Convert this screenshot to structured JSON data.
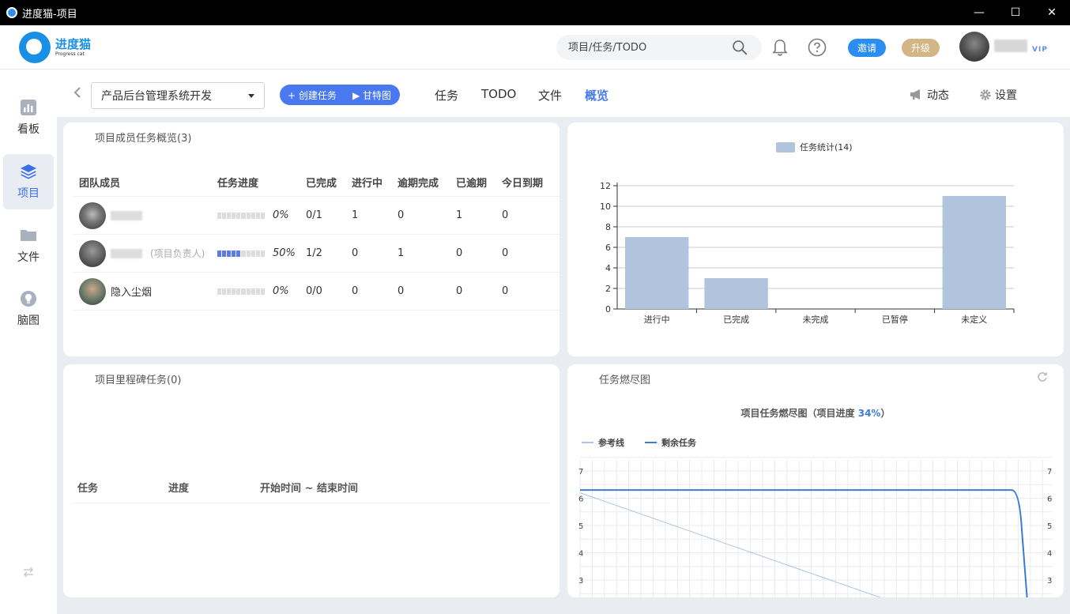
{
  "window": {
    "title": "进度猫-项目",
    "minimize": "—",
    "maximize": "☐",
    "close": "✕"
  },
  "header": {
    "logo_cn": "进度猫",
    "logo_en": "Progress cat",
    "search_placeholder": "项目/任务/TODO",
    "invite_label": "邀请",
    "upgrade_label": "升级",
    "vip_label": "VIP"
  },
  "sidebar": {
    "items": [
      {
        "label": "看板",
        "icon": "chart-board-icon",
        "active": false
      },
      {
        "label": "项目",
        "icon": "layers-icon",
        "active": true
      },
      {
        "label": "文件",
        "icon": "folder-icon",
        "active": false
      },
      {
        "label": "脑图",
        "icon": "bulb-icon",
        "active": false
      }
    ]
  },
  "toolbar": {
    "project_name": "产品后台管理系统开发",
    "create_task_label": "+ 创建任务",
    "gantt_label": "▶ 甘特图",
    "tabs": [
      {
        "label": "任务",
        "active": false
      },
      {
        "label": "TODO",
        "active": false
      },
      {
        "label": "文件",
        "active": false
      },
      {
        "label": "概览",
        "active": true
      }
    ],
    "activity_label": "动态",
    "settings_label": "设置"
  },
  "members_card": {
    "title": "项目成员任务概览(3)",
    "columns": [
      "团队成员",
      "任务进度",
      "已完成",
      "进行中",
      "逾期完成",
      "已逾期",
      "今日到期"
    ],
    "rows": [
      {
        "name": "",
        "role": "",
        "progress": 0,
        "progress_label": "0%",
        "done": "0/1",
        "in_progress": "1",
        "overdue_done": "0",
        "overdue": "1",
        "due_today": "0"
      },
      {
        "name": "",
        "role": "(项目负责人)",
        "progress": 0.5,
        "progress_label": "50%",
        "done": "1/2",
        "in_progress": "0",
        "overdue_done": "1",
        "overdue": "0",
        "due_today": "0"
      },
      {
        "name": "隐入尘烟",
        "role": "",
        "progress": 0,
        "progress_label": "0%",
        "done": "0/0",
        "in_progress": "0",
        "overdue_done": "0",
        "overdue": "0",
        "due_today": "0"
      }
    ]
  },
  "milestone_card": {
    "title": "项目里程碑任务(0)",
    "columns": [
      "任务",
      "进度",
      "开始时间 ~ 结束时间"
    ]
  },
  "burndown_card": {
    "title": "任务燃尽图",
    "refresh_icon": "refresh-icon"
  },
  "chart_data": [
    {
      "type": "bar",
      "legend": "任务统计(14)",
      "categories": [
        "进行中",
        "已完成",
        "未完成",
        "已暂停",
        "未定义"
      ],
      "values": [
        7,
        3,
        0,
        0,
        11
      ],
      "ylim": [
        0,
        12
      ],
      "yticks": [
        0,
        2,
        4,
        6,
        8,
        10,
        12
      ],
      "color": "#b0c4de",
      "grid": true
    },
    {
      "type": "line",
      "title_prefix": "项目任务燃尽图（项目进度 ",
      "title_value": "34%",
      "title_suffix": "）",
      "series": [
        {
          "name": "参考线",
          "color": "#b0c4de"
        },
        {
          "name": "剩余任务",
          "color": "#3a7bd5"
        }
      ],
      "yticks_visible": [
        3,
        4,
        5,
        6,
        7
      ],
      "reference_start": 6.2,
      "remaining_value": 6.3,
      "grid": true,
      "accent": "#3a7bd5"
    }
  ]
}
